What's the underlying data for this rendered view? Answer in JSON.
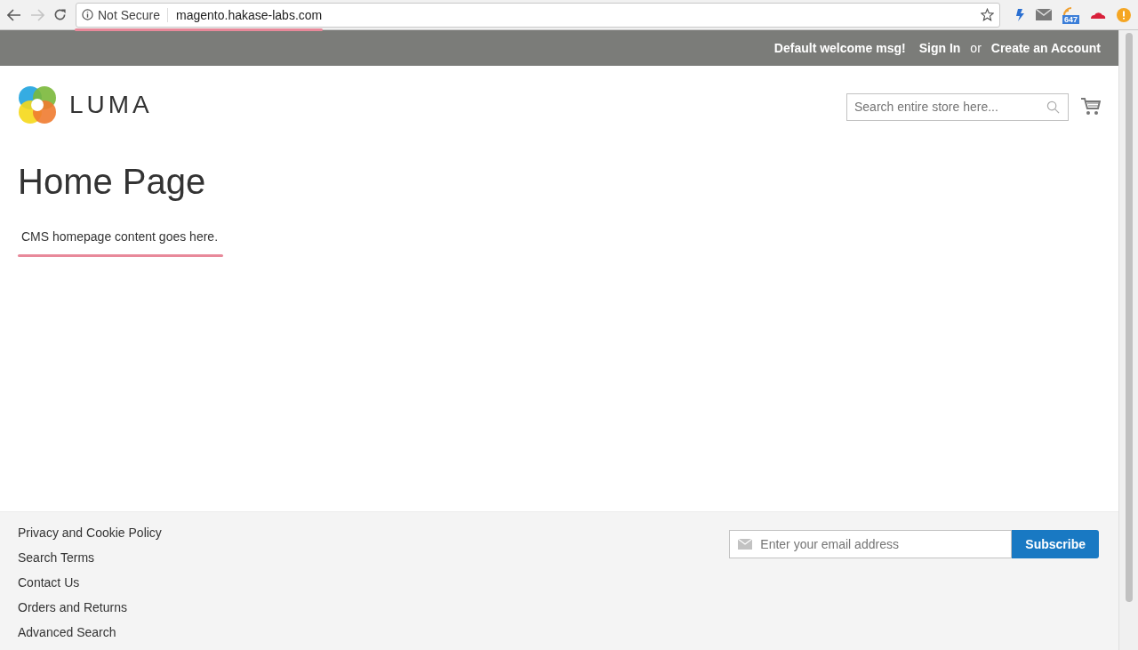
{
  "browser": {
    "security": "Not Secure",
    "url": "magento.hakase-labs.com",
    "extension_badge": "647"
  },
  "top_bar": {
    "welcome": "Default welcome msg!",
    "sign_in": "Sign In",
    "or": "or",
    "create_account": "Create an Account"
  },
  "header": {
    "logo_text": "LUMA",
    "search": {
      "placeholder": "Search entire store here..."
    }
  },
  "page": {
    "title": "Home Page",
    "content": "CMS homepage content goes here."
  },
  "footer": {
    "links": [
      "Privacy and Cookie Policy",
      "Search Terms",
      "Contact Us",
      "Orders and Returns",
      "Advanced Search"
    ],
    "newsletter": {
      "placeholder": "Enter your email address",
      "button": "Subscribe"
    }
  }
}
